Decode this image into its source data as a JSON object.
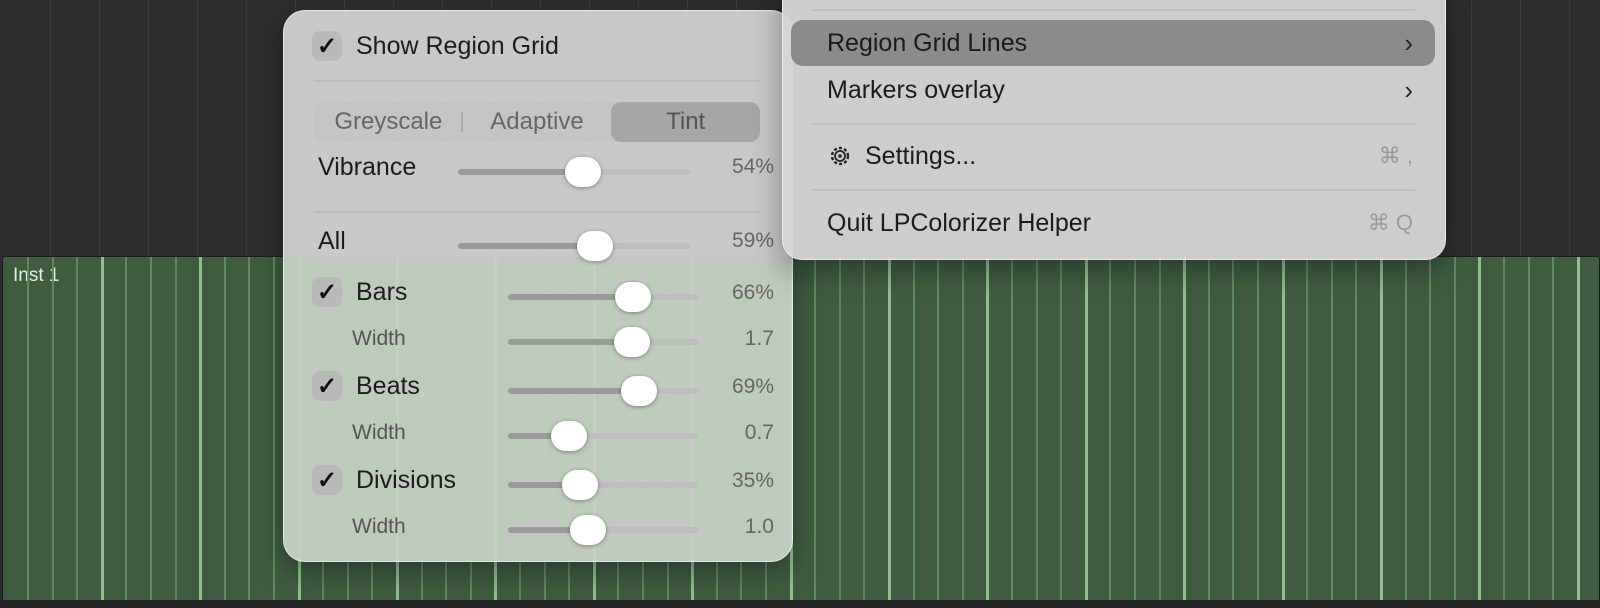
{
  "region": {
    "name": "Inst 1"
  },
  "popover": {
    "show_region_grid": {
      "label": "Show Region Grid",
      "checked": true
    },
    "color_mode": {
      "options": [
        "Greyscale",
        "Adaptive",
        "Tint"
      ],
      "selected": "Tint"
    },
    "vibrance": {
      "label": "Vibrance",
      "value_text": "54%",
      "value": 0.54
    },
    "all": {
      "label": "All",
      "value_text": "59%",
      "value": 0.59
    },
    "bars": {
      "label": "Bars",
      "checked": true,
      "value_text": "66%",
      "value": 0.66,
      "width": {
        "label": "Width",
        "value_text": "1.7",
        "value": 0.65
      }
    },
    "beats": {
      "label": "Beats",
      "checked": true,
      "value_text": "69%",
      "value": 0.69,
      "width": {
        "label": "Width",
        "value_text": "0.7",
        "value": 0.32
      }
    },
    "divisions": {
      "label": "Divisions",
      "checked": true,
      "value_text": "35%",
      "value": 0.38,
      "width": {
        "label": "Width",
        "value_text": "1.0",
        "value": 0.42
      }
    }
  },
  "menu": {
    "items": [
      {
        "label": "Region Grid Lines",
        "submenu": true,
        "highlighted": true
      },
      {
        "label": "Markers overlay",
        "submenu": true
      },
      {
        "label": "Settings...",
        "shortcut": "⌘ ,",
        "icon": "gear-icon"
      },
      {
        "label": "Quit LPColorizer Helper",
        "shortcut": "⌘ Q"
      }
    ],
    "chevron": "›"
  },
  "colors": {
    "region_fill": "#3f5c40",
    "grid_line": "#8fbf8c",
    "highlight": "#8b8b8b"
  }
}
